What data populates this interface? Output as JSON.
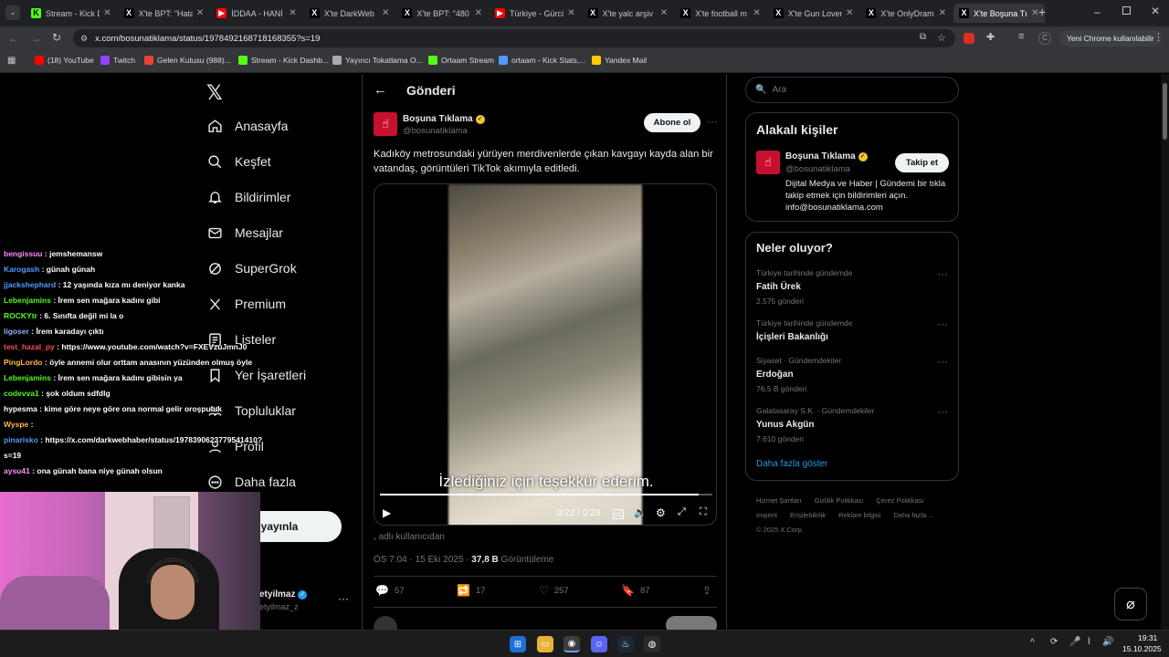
{
  "tabs": [
    {
      "title": "Stream - Kick D",
      "fav": "K",
      "color": "#53fc18"
    },
    {
      "title": "X'te BPT: \"Hata",
      "fav": "X",
      "color": "#000"
    },
    {
      "title": "İDDAA - HANİ",
      "fav": "▶",
      "color": "#ff0000"
    },
    {
      "title": "X'te DarkWeb",
      "fav": "X",
      "color": "#000"
    },
    {
      "title": "X'te BPT: \"480",
      "fav": "X",
      "color": "#000"
    },
    {
      "title": "Türkiye - Gürcü",
      "fav": "▶",
      "color": "#ff0000"
    },
    {
      "title": "X'te yalc arşiv",
      "fav": "X",
      "color": "#000"
    },
    {
      "title": "X'te football m",
      "fav": "X",
      "color": "#000"
    },
    {
      "title": "X'te Gun Lover",
      "fav": "X",
      "color": "#000"
    },
    {
      "title": "X'te OnlyDram",
      "fav": "X",
      "color": "#000"
    },
    {
      "title": "X'te Boşuna Tı",
      "fav": "X",
      "color": "#000",
      "active": true
    }
  ],
  "address": {
    "url": "x.com/bosunatiklama/status/1978492168718168355?s=19",
    "profile": "C",
    "update_label": "Yeni Chrome kullanılabilir"
  },
  "bookmarks": [
    {
      "label": "(18) YouTube",
      "color": "#ff0000"
    },
    {
      "label": "Twitch",
      "color": "#9146ff"
    },
    {
      "label": "Gelen Kutusu (988)...",
      "color": "#ea4335"
    },
    {
      "label": "Stream - Kick Dashb...",
      "color": "#53fc18"
    },
    {
      "label": "Yayıncı Tokatlama O...",
      "color": "#aaaaaa"
    },
    {
      "label": "Ortaam Stream",
      "color": "#53fc18"
    },
    {
      "label": "ortaam - Kick Stats,...",
      "color": "#5599ff"
    },
    {
      "label": "Yandex Mail",
      "color": "#ffcc00"
    }
  ],
  "nav": {
    "items": [
      "Anasayfa",
      "Keşfet",
      "Bildirimler",
      "Mesajlar",
      "SuperGrok",
      "Premium",
      "Listeler",
      "Yer İşaretleri",
      "Topluluklar",
      "Profil",
      "Daha fazla"
    ],
    "post_button": "eri yayınla",
    "account_name": "etyilmaz",
    "account_handle": "etyilmaz_z"
  },
  "header": {
    "title": "Gönderi"
  },
  "post": {
    "author": "Boşuna Tıklama",
    "handle": "@bosunatiklama",
    "follow_label": "Abone ol",
    "text": "Kadıköy metrosundaki yürüyen merdivenlerde çıkan kavgayı kayda alan bir vatandaş, görüntüleri TikTok akımıyla editledi.",
    "subtitle": "İzlediğiniz için teşekkür ederim.",
    "time": "0:22 / 0:23",
    "progress": 0.96,
    "from_label": "adlı kullanıcıdan",
    "date": "ÖS 7:04 · 15 Eki 2025",
    "views": "37,8 B",
    "views_label": "Görüntüleme",
    "replies": "57",
    "reposts": "17",
    "likes": "257",
    "bookmarks": "87"
  },
  "search": {
    "placeholder": "Ara"
  },
  "related": {
    "title": "Alakalı kişiler",
    "name": "Boşuna Tıklama",
    "handle": "@bosunatiklama",
    "follow": "Takip et",
    "bio": "Dijital Medya ve Haber | Gündemi bir tıkla takip etmek için bildirimleri açın. info@bosunatiklama.com"
  },
  "trends": {
    "title": "Neler oluyor?",
    "items": [
      {
        "cat": "Türkiye tarihinde gündemde",
        "name": "Fatih Ürek",
        "count": "2.575 gönderi"
      },
      {
        "cat": "Türkiye tarihinde gündemde",
        "name": "İçişleri Bakanlığı",
        "count": ""
      },
      {
        "cat": "Siyaset · Gündemdekiler",
        "name": "Erdoğan",
        "count": "76,5 B gönderi"
      },
      {
        "cat": "Galatasaray S.K. · Gündemdekiler",
        "name": "Yunus Akgün",
        "count": "7.610 gönderi"
      }
    ],
    "show_more": "Daha fazla göster"
  },
  "footer": {
    "line1": [
      "Hizmet Şartları",
      "Gizlilik Politikası",
      "Çerez Politikası"
    ],
    "line2": [
      "Imprint",
      "Erişilebilirlik",
      "Reklam bilgisi",
      "Daha fazla ..."
    ],
    "copyright": "© 2025 X Corp."
  },
  "chat": [
    {
      "user": "bengissuu",
      "color": "#ff8cff",
      "msg": ": jemshemansw"
    },
    {
      "user": "Karogash",
      "color": "#5599ff",
      "msg": ": günah günah"
    },
    {
      "user": "jjackshephard",
      "color": "#5599ff",
      "msg": ": 12 yaşında kıza mı deniyor kanka"
    },
    {
      "user": "Lebenjamins",
      "color": "#53fc18",
      "msg": ": İrem sen mağara kadını gibi"
    },
    {
      "user": "ROCKYtr",
      "color": "#53fc18",
      "msg": ": 6. Sınıfta değil mi la o"
    },
    {
      "user": "ligoser",
      "color": "#8ab4f8",
      "msg": ": İrem karadayı çıktı"
    },
    {
      "user": "test_hazal_py",
      "color": "#ff4d4d",
      "msg": ": https://www.youtube.com/watch?v=FXEVzuJmnJ0"
    },
    {
      "user": "PingLordo",
      "color": "#ffb84d",
      "msg": ": öyle annemi olur orttam anasının yüzünden olmuş öyle"
    },
    {
      "user": "Lebenjamins",
      "color": "#53fc18",
      "msg": ": İrem sen mağara kadını gibisin ya"
    },
    {
      "user": "codevva1",
      "color": "#53fc18",
      "msg": ": şok oldum sdfdlg"
    },
    {
      "user": "hypesma",
      "color": "#ffffff",
      "msg": ": kime göre neye göre ona normal gelir oroşpuluk"
    },
    {
      "user": "Wyspe",
      "color": "#ffb84d",
      "msg": ":"
    },
    {
      "user": "pinarisko",
      "color": "#5599ff",
      "msg": ": https://x.com/darkwebhaber/status/1978390623779541410?"
    },
    {
      "user": "",
      "color": "#ffffff",
      "msg": "s=19"
    },
    {
      "user": "aysu41",
      "color": "#ff8cff",
      "msg": ": ona günah bana niye günah olsun"
    }
  ],
  "clock": {
    "time": "19:31",
    "date": "15.10.2025"
  },
  "colors": {
    "accent": "#1d9bf0",
    "background": "#000000",
    "border": "#2f3336",
    "muted": "#71767b",
    "verified": "#f4c430"
  }
}
